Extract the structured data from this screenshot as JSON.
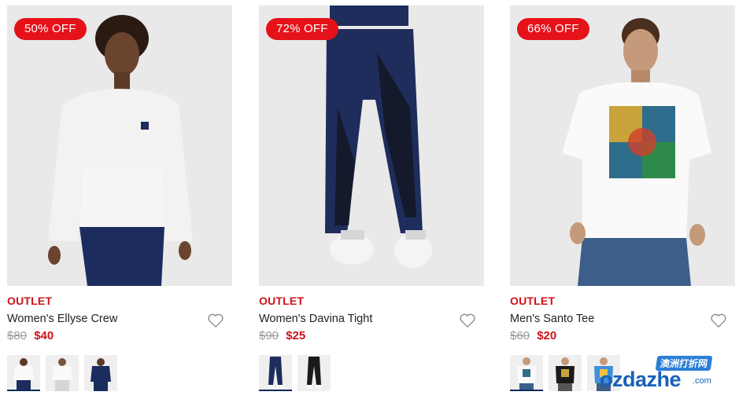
{
  "products": [
    {
      "badge": "50% OFF",
      "tag": "OUTLET",
      "name": "Women's Ellyse Crew",
      "old_price": "$80",
      "price": "$40",
      "image_icon": "woman-white-sweatshirt-photo",
      "swatches": [
        "white-crew-swatch",
        "white-crew-swatch",
        "navy-crew-swatch"
      ]
    },
    {
      "badge": "72% OFF",
      "tag": "OUTLET",
      "name": "Women's Davina Tight",
      "old_price": "$90",
      "price": "$25",
      "image_icon": "navy-leggings-photo",
      "swatches": [
        "navy-tight-swatch",
        "black-tight-swatch"
      ]
    },
    {
      "badge": "66% OFF",
      "tag": "OUTLET",
      "name": "Men's Santo Tee",
      "old_price": "$60",
      "price": "$20",
      "image_icon": "man-graphic-tee-photo",
      "swatches": [
        "white-tee-swatch",
        "black-tee-swatch",
        "blue-tee-swatch"
      ]
    }
  ],
  "watermark": {
    "cn": "澳洲打折网",
    "en": "ozdazhe",
    "suffix": ".com"
  },
  "colors": {
    "accent_red": "#e5121a",
    "price_red": "#d0111a",
    "image_bg": "#e8e8e8",
    "navy": "#1c2c5e"
  }
}
